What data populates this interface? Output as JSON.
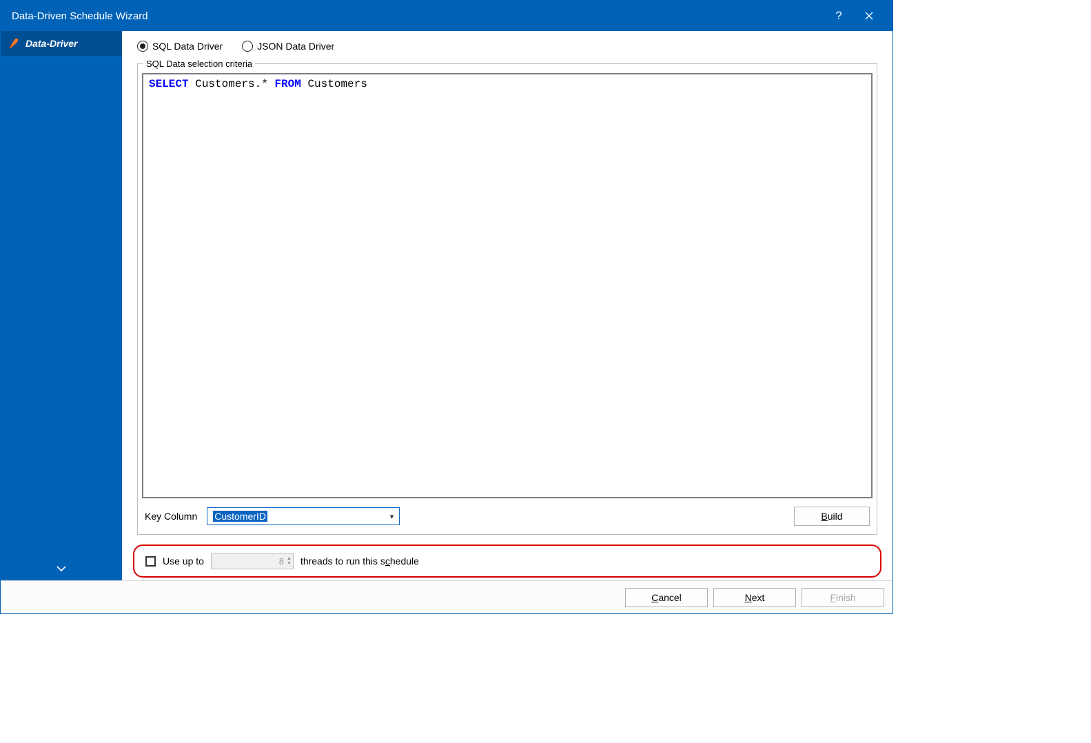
{
  "window": {
    "title": "Data-Driven Schedule Wizard"
  },
  "sidebar": {
    "steps": [
      {
        "label": "Data-Driver"
      }
    ]
  },
  "driver_radios": {
    "sql": {
      "label": "SQL Data Driver",
      "checked": true
    },
    "json": {
      "label": "JSON Data Driver",
      "checked": false
    }
  },
  "criteria": {
    "legend": "SQL Data selection criteria",
    "sql_tokens": {
      "kw1": "SELECT",
      "frag1": " Customers.* ",
      "kw2": "FROM",
      "frag2": " Customers"
    },
    "key_column_label": "Key Column",
    "key_column_value": "CustomerID",
    "build_prefix": "B",
    "build_rest": "uild"
  },
  "threads": {
    "use_up_to": "Use up to",
    "value": "8",
    "suffix_before_underline": "threads to run this s",
    "suffix_underline": "c",
    "suffix_after_underline": "hedule"
  },
  "footer": {
    "cancel_u": "C",
    "cancel_rest": "ancel",
    "next_u": "N",
    "next_rest": "ext",
    "finish_u": "F",
    "finish_rest": "inish"
  }
}
